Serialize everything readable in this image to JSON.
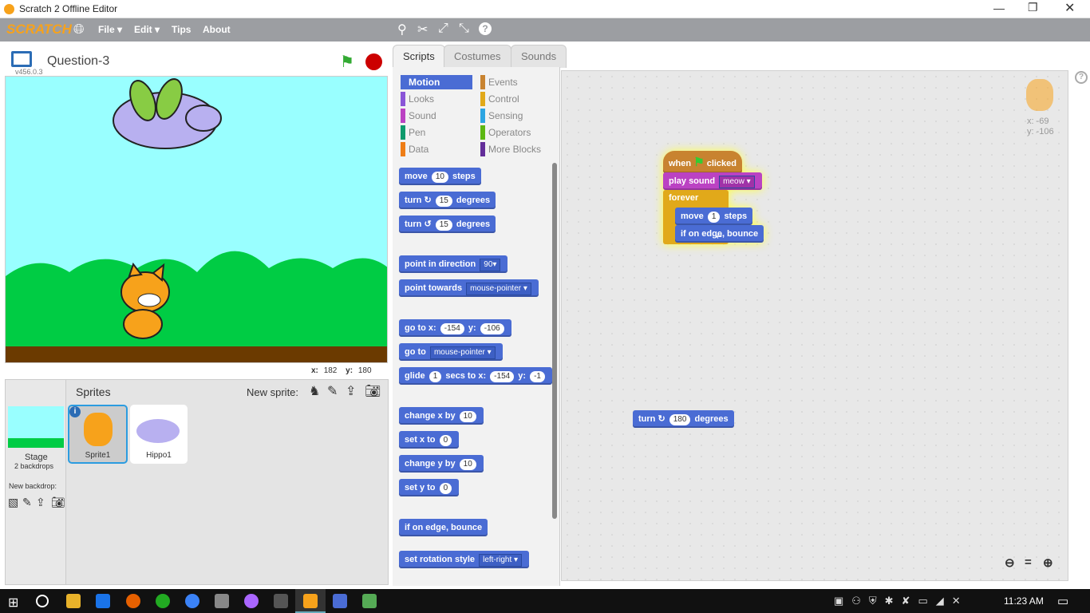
{
  "window": {
    "title": "Scratch 2 Offline Editor"
  },
  "menubar": {
    "logo": "SCRATCH",
    "file": "File ▾",
    "edit": "Edit ▾",
    "tips": "Tips",
    "about": "About"
  },
  "stage": {
    "project_title": "Question-3",
    "version": "v456.0.3",
    "x_label": "x:",
    "x_value": "182",
    "y_label": "y:",
    "y_value": "180"
  },
  "sprites_panel": {
    "title": "Sprites",
    "new_sprite_label": "New sprite:",
    "stage_label": "Stage",
    "stage_backdrops": "2 backdrops",
    "new_backdrop_label": "New backdrop:",
    "sprites": [
      {
        "name": "Sprite1"
      },
      {
        "name": "Hippo1"
      }
    ]
  },
  "tabs": {
    "scripts": "Scripts",
    "costumes": "Costumes",
    "sounds": "Sounds"
  },
  "categories": [
    {
      "label": "Motion",
      "color": "#4a6cd4"
    },
    {
      "label": "Events",
      "color": "#c88330"
    },
    {
      "label": "Looks",
      "color": "#8a55d7"
    },
    {
      "label": "Control",
      "color": "#e1a91a"
    },
    {
      "label": "Sound",
      "color": "#bb42c3"
    },
    {
      "label": "Sensing",
      "color": "#2ca5e2"
    },
    {
      "label": "Pen",
      "color": "#0e9a6c"
    },
    {
      "label": "Operators",
      "color": "#5cb712"
    },
    {
      "label": "Data",
      "color": "#ee7d16"
    },
    {
      "label": "More Blocks",
      "color": "#632d99"
    }
  ],
  "palette_blocks": [
    {
      "a": "move",
      "v": "10",
      "b": "steps"
    },
    {
      "a": "turn ↻",
      "v": "15",
      "b": "degrees"
    },
    {
      "a": "turn ↺",
      "v": "15",
      "b": "degrees"
    },
    {
      "a": "point in direction",
      "d": "90▾"
    },
    {
      "a": "point towards",
      "d": "mouse-pointer ▾"
    },
    {
      "a": "go to x:",
      "v": "-154",
      "b": "y:",
      "v2": "-106"
    },
    {
      "a": "go to",
      "d": "mouse-pointer ▾"
    },
    {
      "a": "glide",
      "v": "1",
      "b": "secs to x:",
      "v2": "-154",
      "c": "y:",
      "v3": "-1"
    },
    {
      "a": "change x by",
      "v": "10"
    },
    {
      "a": "set x to",
      "v": "0"
    },
    {
      "a": "change y by",
      "v": "10"
    },
    {
      "a": "set y to",
      "v": "0"
    },
    {
      "a": "if on edge, bounce"
    },
    {
      "a": "set rotation style",
      "d": "left-right ▾"
    }
  ],
  "script": {
    "hat_when": "when",
    "hat_clicked": "clicked",
    "play_sound": "play sound",
    "sound_name": "meow ▾",
    "forever": "forever",
    "move_a": "move",
    "move_v": "1",
    "move_b": "steps",
    "bounce": "if on edge, bounce",
    "turn_a": "turn ↻",
    "turn_v": "180",
    "turn_b": "degrees"
  },
  "sprite_info": {
    "x": "x: -69",
    "y": "y: -106"
  },
  "taskbar": {
    "time": "11:23 AM"
  }
}
